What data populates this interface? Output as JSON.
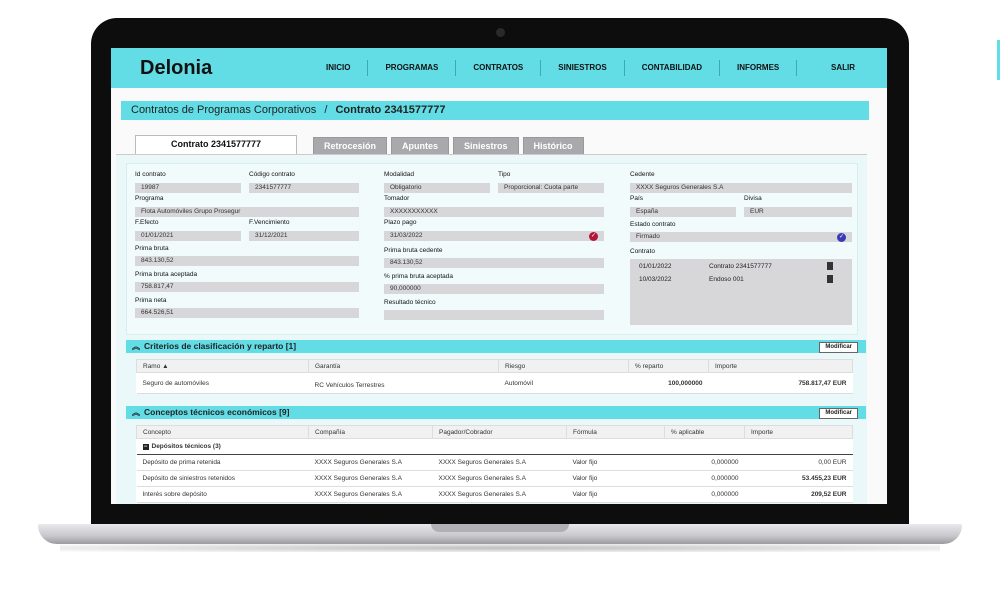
{
  "app": {
    "title": "Delonia"
  },
  "nav": {
    "items": [
      "INICIO",
      "PROGRAMAS",
      "CONTRATOS",
      "SINIESTROS",
      "CONTABILIDAD",
      "INFORMES"
    ],
    "logout": "SALIR"
  },
  "breadcrumb": {
    "parent": "Contratos de Programas Corporativos",
    "separator": "/",
    "current": "Contrato 2341577777"
  },
  "tabs": [
    "Contrato 2341577777",
    "Retrocesión",
    "Apuntes",
    "Siniestros",
    "Histórico"
  ],
  "contract": {
    "id_label": "Id contrato",
    "id": "19987",
    "code_label": "Código contrato",
    "code": "2341577777",
    "program_label": "Programa",
    "program": "Flota Automóviles Grupo Prosegur",
    "effect_label": "F.Efecto",
    "effect": "01/01/2021",
    "expiry_label": "F.Vencimiento",
    "expiry": "31/12/2021",
    "gross_label": "Prima bruta",
    "gross": "843.130,52",
    "gross_acc_label": "Prima bruta aceptada",
    "gross_acc": "758.817,47",
    "net_label": "Prima neta",
    "net": "664.526,51",
    "modality_label": "Modalidad",
    "modality": "Obligatorio",
    "type_label": "Tipo",
    "type": "Proporcional: Cuota parte",
    "broker_label": "Tomador",
    "broker": "XXXXXXXXXXX",
    "term_label": "Plazo pago",
    "term": "31/03/2022",
    "gross_ced_label": "Prima bruta cedente",
    "gross_ced": "843.130,52",
    "pct_acc_label": "% prima bruta aceptada",
    "pct_acc": "90,000000",
    "result_label": "Resultado técnico",
    "result": "",
    "cedent_label": "Cedente",
    "cedent": "XXXX Seguros Generales S.A",
    "country_label": "País",
    "country": "España",
    "currency_label": "Divisa",
    "currency": "EUR",
    "status_label": "Estado contrato",
    "status": "Firmado",
    "docs_label": "Contrato",
    "docs": [
      {
        "date": "01/01/2022",
        "name": "Contrato  2341577777"
      },
      {
        "date": "10/03/2022",
        "name": "Endoso 001"
      }
    ]
  },
  "criteria": {
    "title": "Criterios de clasificación y reparto [1]",
    "modify": "Modificar",
    "columns": [
      "Ramo",
      "Garantía",
      "Riesgo",
      "% reparto",
      "Importe"
    ],
    "rows": [
      {
        "ramo": "Seguro de automóviles",
        "garantia": "RC Vehículos Terrestres",
        "riesgo": "Automóvil",
        "reparto": "100,000000",
        "importe": "758.817,47 EUR"
      }
    ]
  },
  "concepts": {
    "title": "Conceptos técnicos económicos [9]",
    "modify": "Modificar",
    "columns": [
      "Concepto",
      "Compañía",
      "Pagador/Cobrador",
      "Fórmula",
      "% aplicable",
      "Importe"
    ],
    "group": "Depósitos técnicos (3)",
    "rows": [
      {
        "concepto": "Depósito de prima retenida",
        "compania": "XXXX Seguros Generales S.A",
        "pagador": "XXXX Seguros Generales S.A",
        "formula": "Valor fijo",
        "pct": "0,000000",
        "importe": "0,00 EUR"
      },
      {
        "concepto": "Depósito de siniestros retenidos",
        "compania": "XXXX Seguros Generales S.A",
        "pagador": "XXXX Seguros Generales S.A",
        "formula": "Valor fijo",
        "pct": "0,000000",
        "importe": "53.455,23 EUR"
      },
      {
        "concepto": "Interés sobre depósito",
        "compania": "XXXX Seguros Generales S.A",
        "pagador": "XXXX Seguros Generales S.A",
        "formula": "Valor fijo",
        "pct": "0,000000",
        "importe": "209,52 EUR"
      }
    ]
  }
}
